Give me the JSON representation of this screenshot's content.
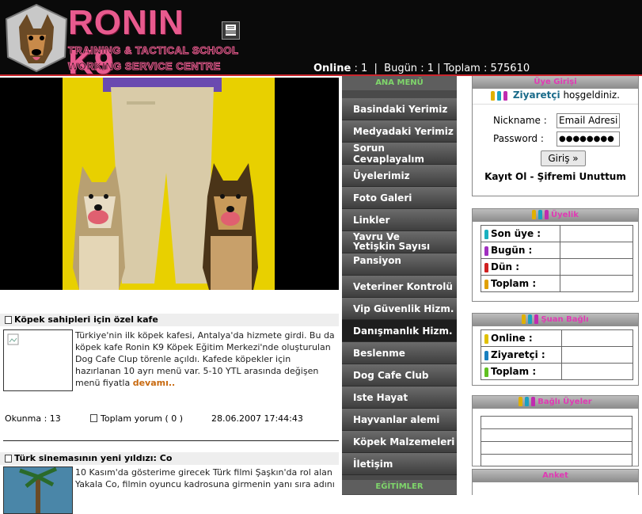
{
  "header": {
    "brand": "RONIN K9",
    "tagline_1": "TRAINING & TACTICAL SCHOOL",
    "tagline_2": "WORKING SERVICE CENTRE",
    "online_label": "Online",
    "online_value": ": 1",
    "today_label": "Bugün",
    "today_value": ": 1",
    "total_label": "Toplam",
    "total_value": ": 575610",
    "separator": "|"
  },
  "news": [
    {
      "title": "Köpek sahipleri için özel kafe",
      "body": "Türkiye'nin ilk köpek kafesi, Antalya'da hizmete girdi. Bu da köpek kafe Ronin K9 Köpek Eğitim Merkezi'nde oluşturulan Dog Cafe Clup törenle açıldı. Kafede köpekler için hazırlanan 10 ayrı menü var. 5-10 YTL arasında değişen menü fiyatla",
      "more": "devamı..",
      "reads": "Okunma : 13",
      "comments": "Toplam yorum ( 0 )",
      "date": "28.06.2007 17:44:43"
    },
    {
      "title": "Türk sinemasının yeni yıldızı: Co",
      "body": "10 Kasım'da gösterime girecek Türk filmi Şaşkın'da rol alan Yakala Co, filmin oyuncu kadrosuna girmenin yanı sıra adını"
    }
  ],
  "menu": {
    "heading": "ANA MENÜ",
    "items": [
      "Basindaki Yerimiz",
      "Medyadaki Yerimiz",
      "Sorun Cevaplayalım",
      "Üyelerimiz",
      "Foto Galeri",
      "Linkler",
      "Yavru Ve Yetişkin Sayısı",
      "Pansiyon",
      "Veteriner Kontrolü",
      "Vip Güvenlik Hizm.",
      "Danışmanlık Hizm.",
      "Beslenme",
      "Dog Cafe Club",
      "Iste Hayat",
      "Hayvanlar alemi",
      "Köpek Malzemeleri",
      "İletişim"
    ],
    "heading_2": "EĞİTİMLER"
  },
  "login": {
    "heading": "Üye Girişi",
    "welcome_name": "Ziyaretçi",
    "welcome_rest": "hoşgeldiniz.",
    "nick_label": "Nickname :",
    "nick_value": "Email Adresi",
    "pass_label": "Password :",
    "pass_value": "●●●●●●●●",
    "submit": "Giriş »",
    "register": "Kayıt Ol",
    "dash": " - ",
    "forgot": "Şifremi Unuttum"
  },
  "members": {
    "heading": "Üyelik",
    "rows": [
      "Son üye :",
      "Bugün :",
      "Dün :",
      "Toplam :"
    ]
  },
  "current": {
    "heading": "Şuan Bağlı",
    "rows": [
      "Online :",
      "Ziyaretçi :",
      "Toplam :"
    ]
  },
  "connected": {
    "heading": "Bağlı Üyeler"
  },
  "poll": {
    "heading": "Anket"
  },
  "colors": {
    "accent_pink": "#e85a8e",
    "header_red": "#c9252c",
    "menu_green": "#7fd66b",
    "box_magenta": "#e03ab4",
    "link_teal": "#1a6b8a"
  }
}
